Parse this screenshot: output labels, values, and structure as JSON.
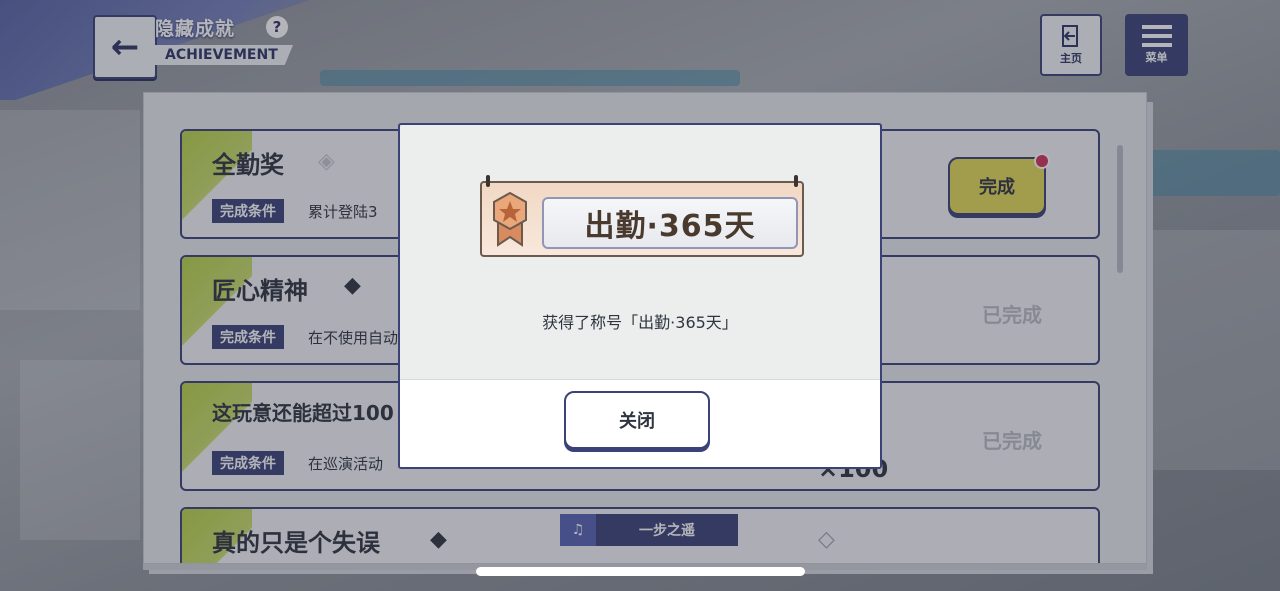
{
  "header": {
    "title_cn": "隐藏成就",
    "title_en": "ACHIEVEMENT",
    "help_label": "?",
    "home_label": "主页",
    "menu_label": "菜单"
  },
  "achievements": [
    {
      "title": "全勤奖",
      "condition_label": "完成条件",
      "condition_text": "累计登陆3",
      "status": "完成"
    },
    {
      "title": "匠心精神",
      "condition_label": "完成条件",
      "condition_text": "在不使用自动",
      "status": "已完成"
    },
    {
      "title": "这玩意还能超过100",
      "condition_label": "完成条件",
      "condition_text": "在巡演活动",
      "status": "已完成",
      "reward": "×100"
    },
    {
      "title": "真的只是个失误",
      "reward_title": "一步之遥"
    }
  ],
  "modal": {
    "badge_text": "出勤·365天",
    "message": "获得了称号「出勤·365天」",
    "close_label": "关闭"
  },
  "colors": {
    "primary": "#3b4277",
    "accent_green": "#b9d44a",
    "complete_yellow": "#e3d958",
    "notify_red": "#d3345a"
  }
}
